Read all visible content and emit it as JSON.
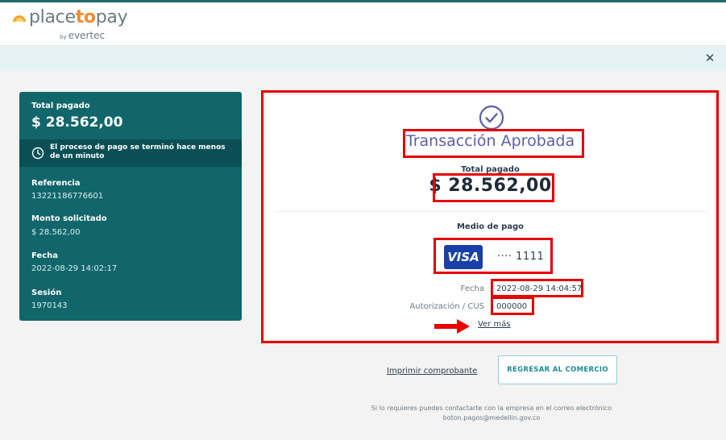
{
  "header": {
    "logo_parts": [
      "place",
      "to",
      "pay"
    ],
    "logo_by": "by",
    "logo_brand": "evertec"
  },
  "banner": {
    "close_icon": "close-icon"
  },
  "summary": {
    "total_label": "Total pagado",
    "total_value": "$ 28.562,00",
    "notice": "El proceso de pago se terminó hace menos de un minuto",
    "fields": [
      {
        "label": "Referencia",
        "value": "13221186776601"
      },
      {
        "label": "Monto solicitado",
        "value": "$ 28.562,00"
      },
      {
        "label": "Fecha",
        "value": "2022-08-29 14:02:17"
      },
      {
        "label": "Sesión",
        "value": "1970143"
      }
    ]
  },
  "result": {
    "title": "Transacción Aprobada",
    "total_label": "Total pagado",
    "total_amount": "$ 28.562,00",
    "payment_method_label": "Medio de pago",
    "card_brand": "VISA",
    "card_digits": "···· 1111",
    "fecha_label": "Fecha",
    "fecha_value": "2022-08-29 14:04:57",
    "auth_label": "Autorización / CUS",
    "auth_value": "000000",
    "ver_mas": "Ver más"
  },
  "actions": {
    "print": "Imprimir comprobante",
    "return": "REGRESAR AL COMERCIO"
  },
  "contact": {
    "line1": "Si lo requieres puedes contactarte con la empresa en el correo electrónico",
    "line2": "boton.pagos@medellin.gov.co"
  },
  "colors": {
    "brand_teal": "#11666b",
    "highlight_red": "#e60000",
    "title_purple": "#5b60a8",
    "visa_blue": "#1a3fa8"
  }
}
